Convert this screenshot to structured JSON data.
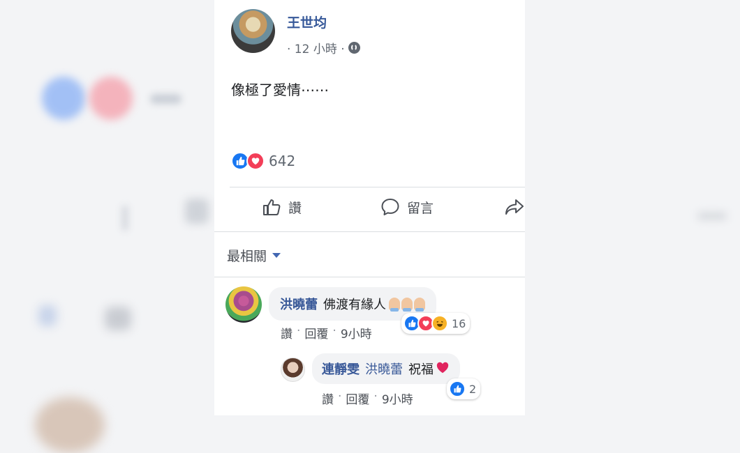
{
  "post": {
    "author": "王世均",
    "time": "· 12 小時 ·",
    "text": "像極了愛情⋯⋯",
    "reaction_count": "642",
    "reaction_icons": [
      "like-icon",
      "love-icon"
    ]
  },
  "actions": {
    "like": "讚",
    "comment": "留言",
    "share_icon": "share-arrow-icon"
  },
  "sort": {
    "label": "最相關"
  },
  "comments": [
    {
      "name": "洪曉蕾",
      "text": "佛渡有緣人",
      "emoji": [
        "folded-hands",
        "folded-hands",
        "folded-hands"
      ],
      "reactions": [
        "like-icon",
        "love-icon",
        "haha-icon"
      ],
      "reaction_count": "16",
      "like": "讚",
      "reply": "回覆",
      "time": "9小時"
    },
    {
      "name": "連靜雯",
      "mention": "洪曉蕾",
      "text": "祝福",
      "emoji": [
        "red-heart"
      ],
      "reactions": [
        "like-icon"
      ],
      "reaction_count": "2",
      "like": "讚",
      "reply": "回覆",
      "time": "9小時"
    }
  ],
  "colors": {
    "link_blue": "#385898",
    "like_blue": "#1877f2",
    "love_red": "#f33e58",
    "haha_yellow": "#f7b125"
  }
}
